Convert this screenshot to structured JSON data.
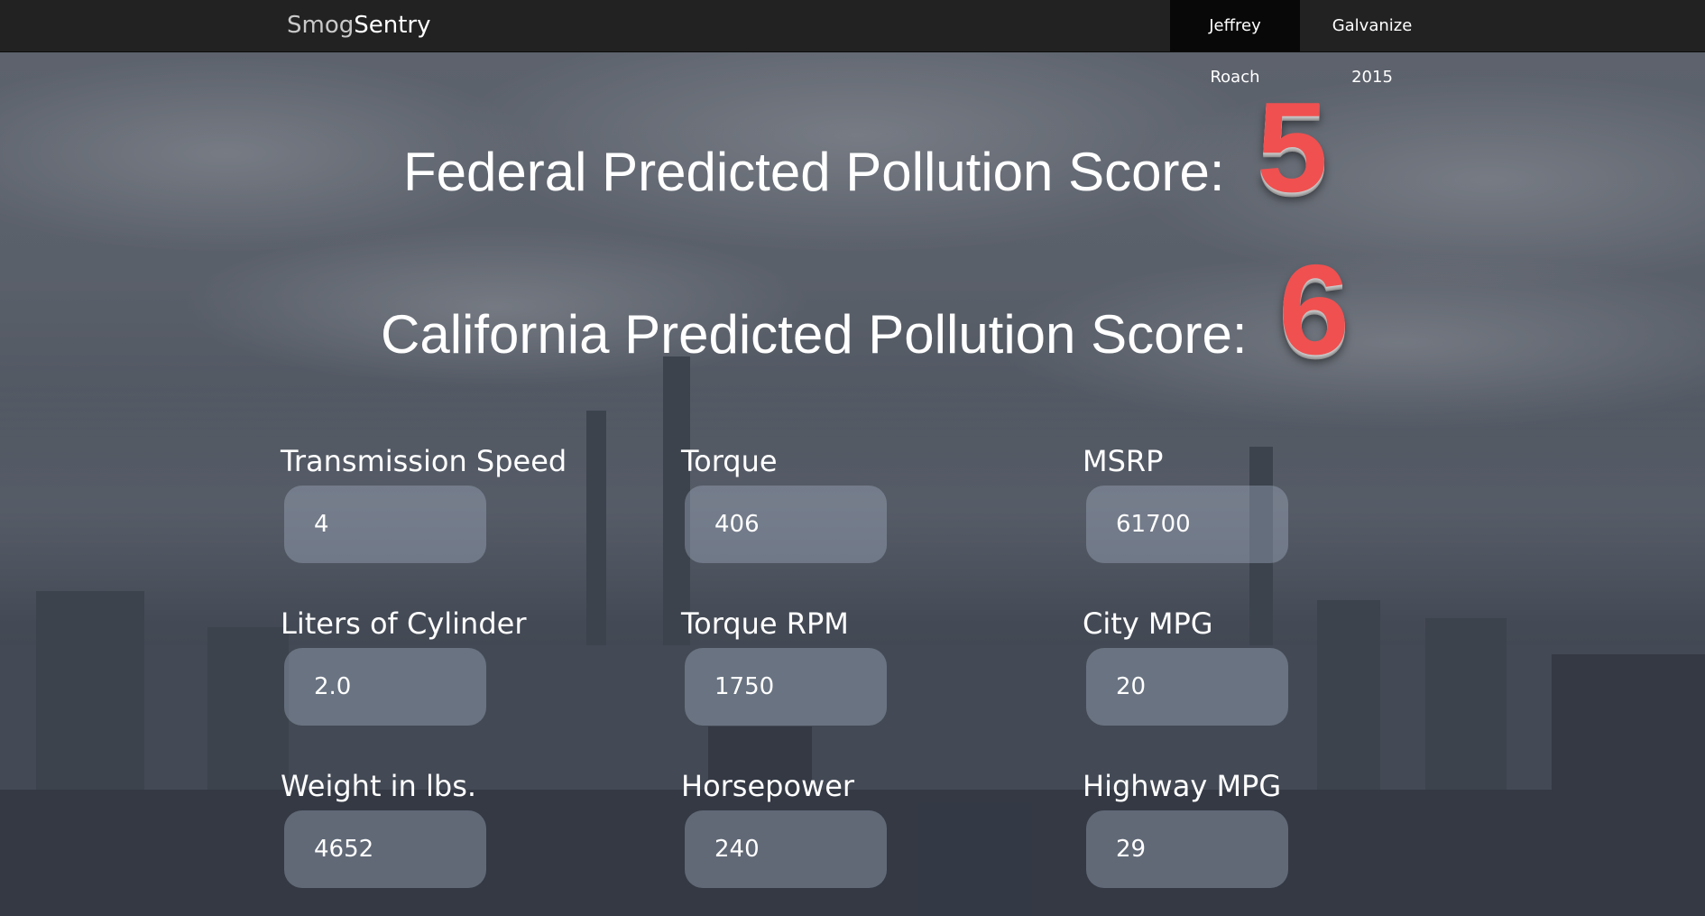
{
  "navbar": {
    "brand_part1": "Smog",
    "brand_part2": "Sentry",
    "links": [
      {
        "label": "Jeffrey Roach",
        "active": true
      },
      {
        "label": "Galvanize 2015",
        "active": false
      }
    ]
  },
  "scores": {
    "federal": {
      "label": "Federal Predicted Pollution Score:",
      "value": "5"
    },
    "california": {
      "label": "California Predicted Pollution Score:",
      "value": "6"
    }
  },
  "fields": {
    "transmission_speed": {
      "label": "Transmission Speed",
      "value": "4"
    },
    "torque": {
      "label": "Torque",
      "value": "406"
    },
    "msrp": {
      "label": "MSRP",
      "value": "61700"
    },
    "liters_of_cylinder": {
      "label": "Liters of Cylinder",
      "value": "2.0"
    },
    "torque_rpm": {
      "label": "Torque RPM",
      "value": "1750"
    },
    "city_mpg": {
      "label": "City MPG",
      "value": "20"
    },
    "weight": {
      "label": "Weight in lbs.",
      "value": "4652"
    },
    "horsepower": {
      "label": "Horsepower",
      "value": "240"
    },
    "highway_mpg": {
      "label": "Highway MPG",
      "value": "29"
    }
  },
  "colors": {
    "score": "#f05050",
    "navbar": "#222222",
    "nav_active": "#080808"
  }
}
